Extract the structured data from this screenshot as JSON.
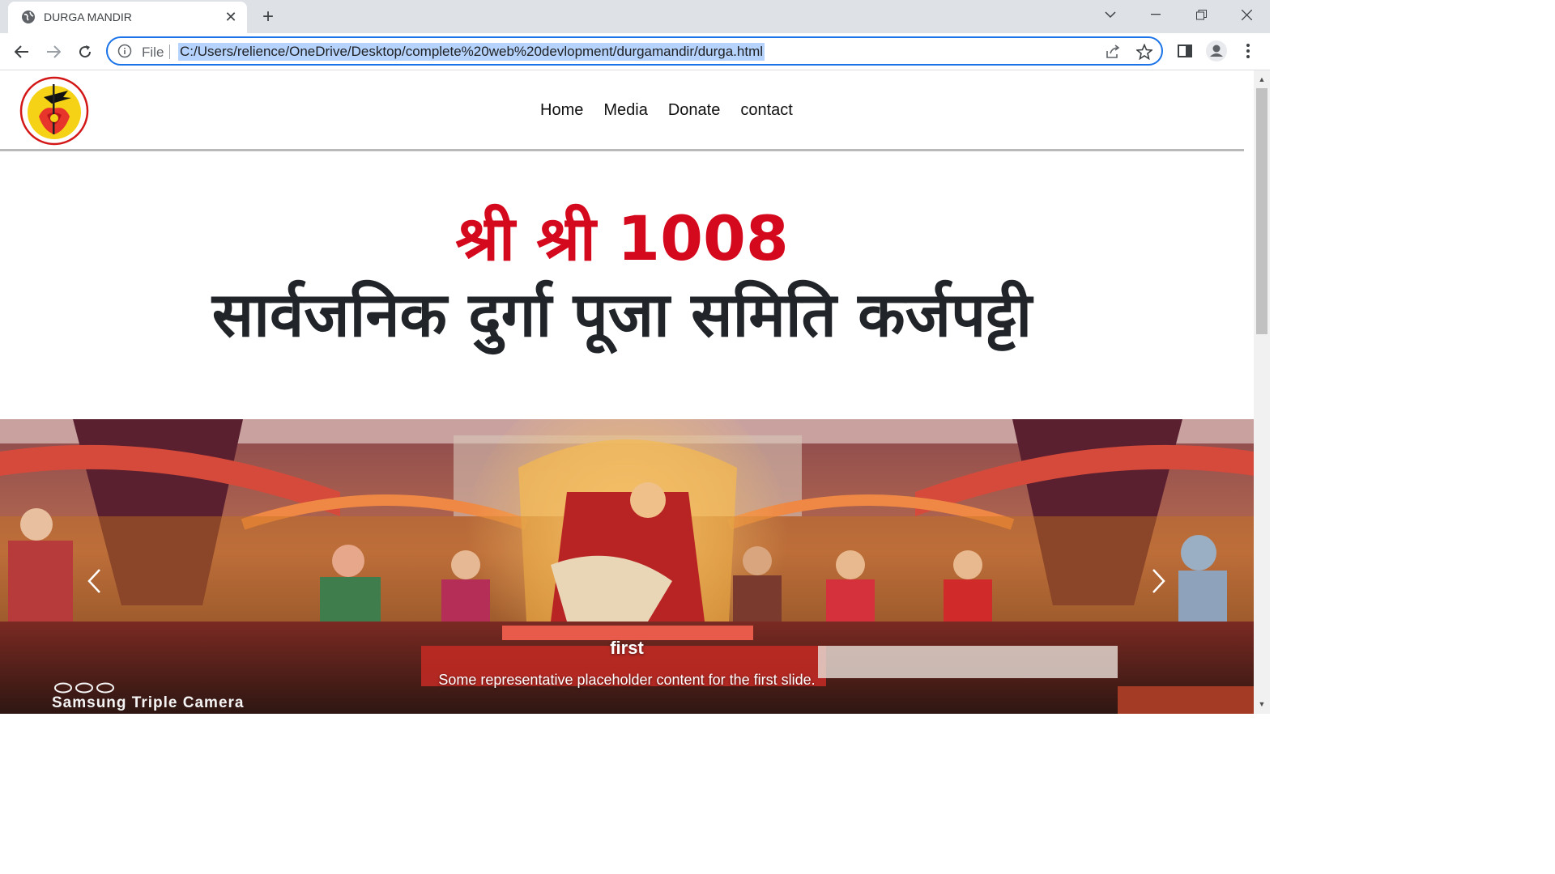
{
  "browser": {
    "tab_title": "DURGA MANDIR",
    "omnibox_scheme": "File",
    "url": "C:/Users/relience/OneDrive/Desktop/complete%20web%20devlopment/durgamandir/durga.html"
  },
  "site": {
    "nav_links": [
      "Home",
      "Media",
      "Donate",
      "contact"
    ],
    "title_line1": "श्री श्री 1008",
    "title_line2": "सार्वजनिक दुर्गा पूजा समिति कर्जपट्टी"
  },
  "carousel": {
    "caption_title": "first",
    "caption_text": "Some representative placeholder content for the first slide.",
    "watermark": "Samsung Triple Camera"
  },
  "colors": {
    "title_red": "#d5091d",
    "title_dark": "#212529",
    "omnibox_focus": "#1a73e8",
    "url_highlight": "#b5d3fc"
  }
}
